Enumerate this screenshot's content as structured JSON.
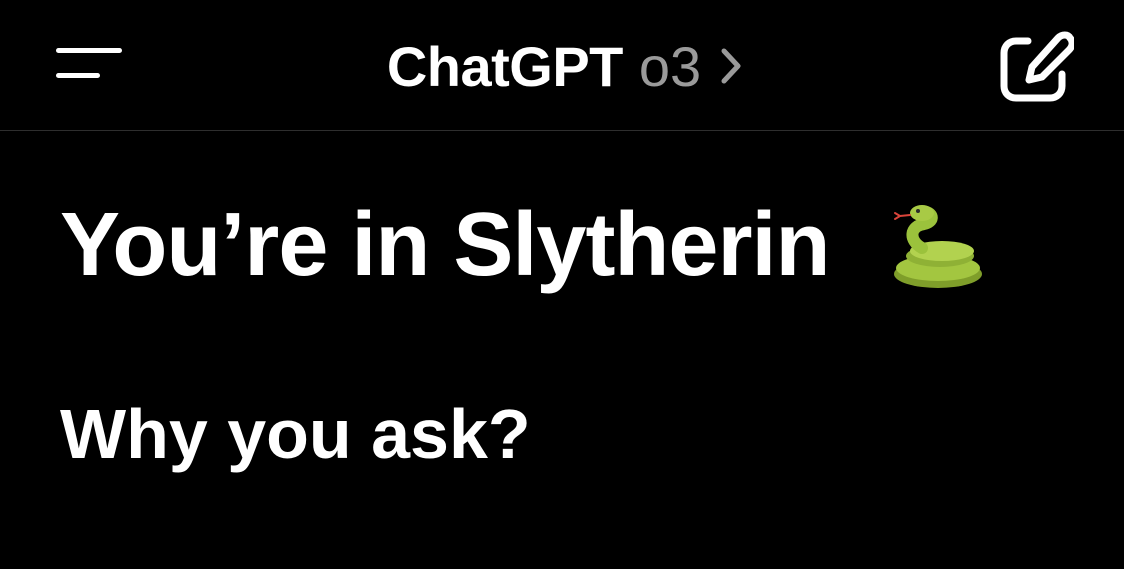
{
  "header": {
    "app_name": "ChatGPT",
    "model_name": "o3",
    "menu_icon": "menu-icon",
    "chevron_icon": "chevron-right-icon",
    "new_chat_icon": "new-chat-edit-icon"
  },
  "message": {
    "heading": "You’re in Slytherin",
    "heading_emoji": "snake-emoji",
    "subheading": "Why you ask?"
  },
  "colors": {
    "background": "#000000",
    "text": "#ffffff",
    "model_text": "#9a9a9a",
    "divider": "#2e2e2e",
    "snake_green": "#9bc23c"
  }
}
